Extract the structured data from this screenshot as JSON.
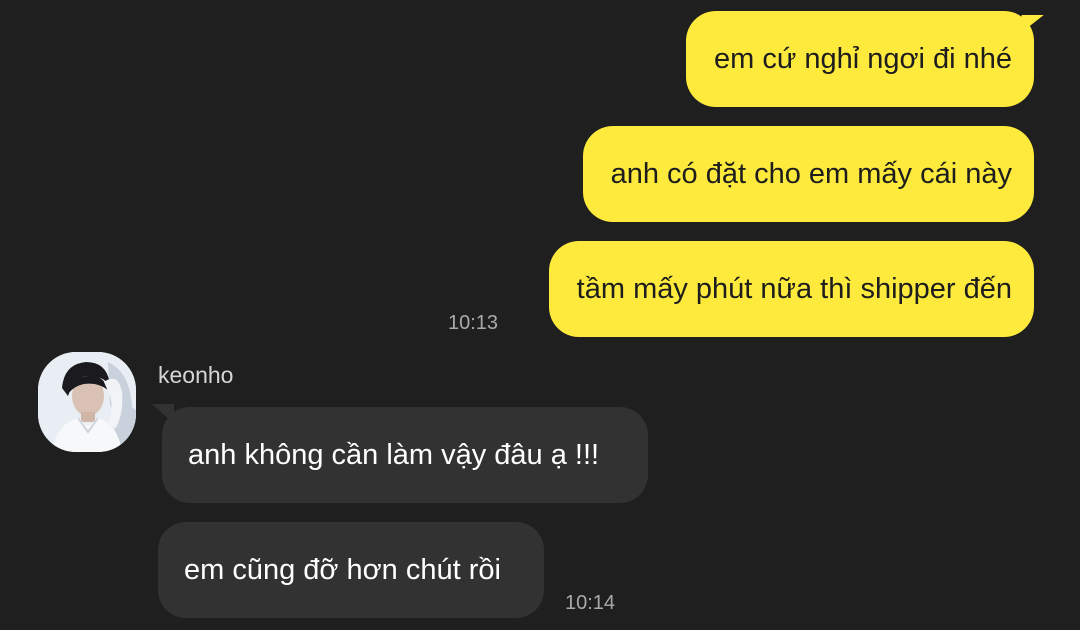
{
  "chat": {
    "outgoing": [
      {
        "text": "em cứ nghỉ ngơi đi nhé"
      },
      {
        "text": "anh có đặt cho em mấy cái này"
      },
      {
        "text": "tầm mấy phút nữa thì shipper đến"
      }
    ],
    "outgoing_time": "10:13",
    "incoming": {
      "sender": "keonho",
      "avatar_icon": "profile-photo",
      "messages": [
        {
          "text": "anh không cần làm vậy đâu ạ !!!"
        },
        {
          "text": "em cũng đỡ hơn chút rồi"
        }
      ],
      "time": "10:14"
    }
  },
  "colors": {
    "background": "#1f1f1f",
    "outgoing_bubble": "#fdea3c",
    "incoming_bubble": "#323232",
    "timestamp": "#a9a9a9"
  }
}
